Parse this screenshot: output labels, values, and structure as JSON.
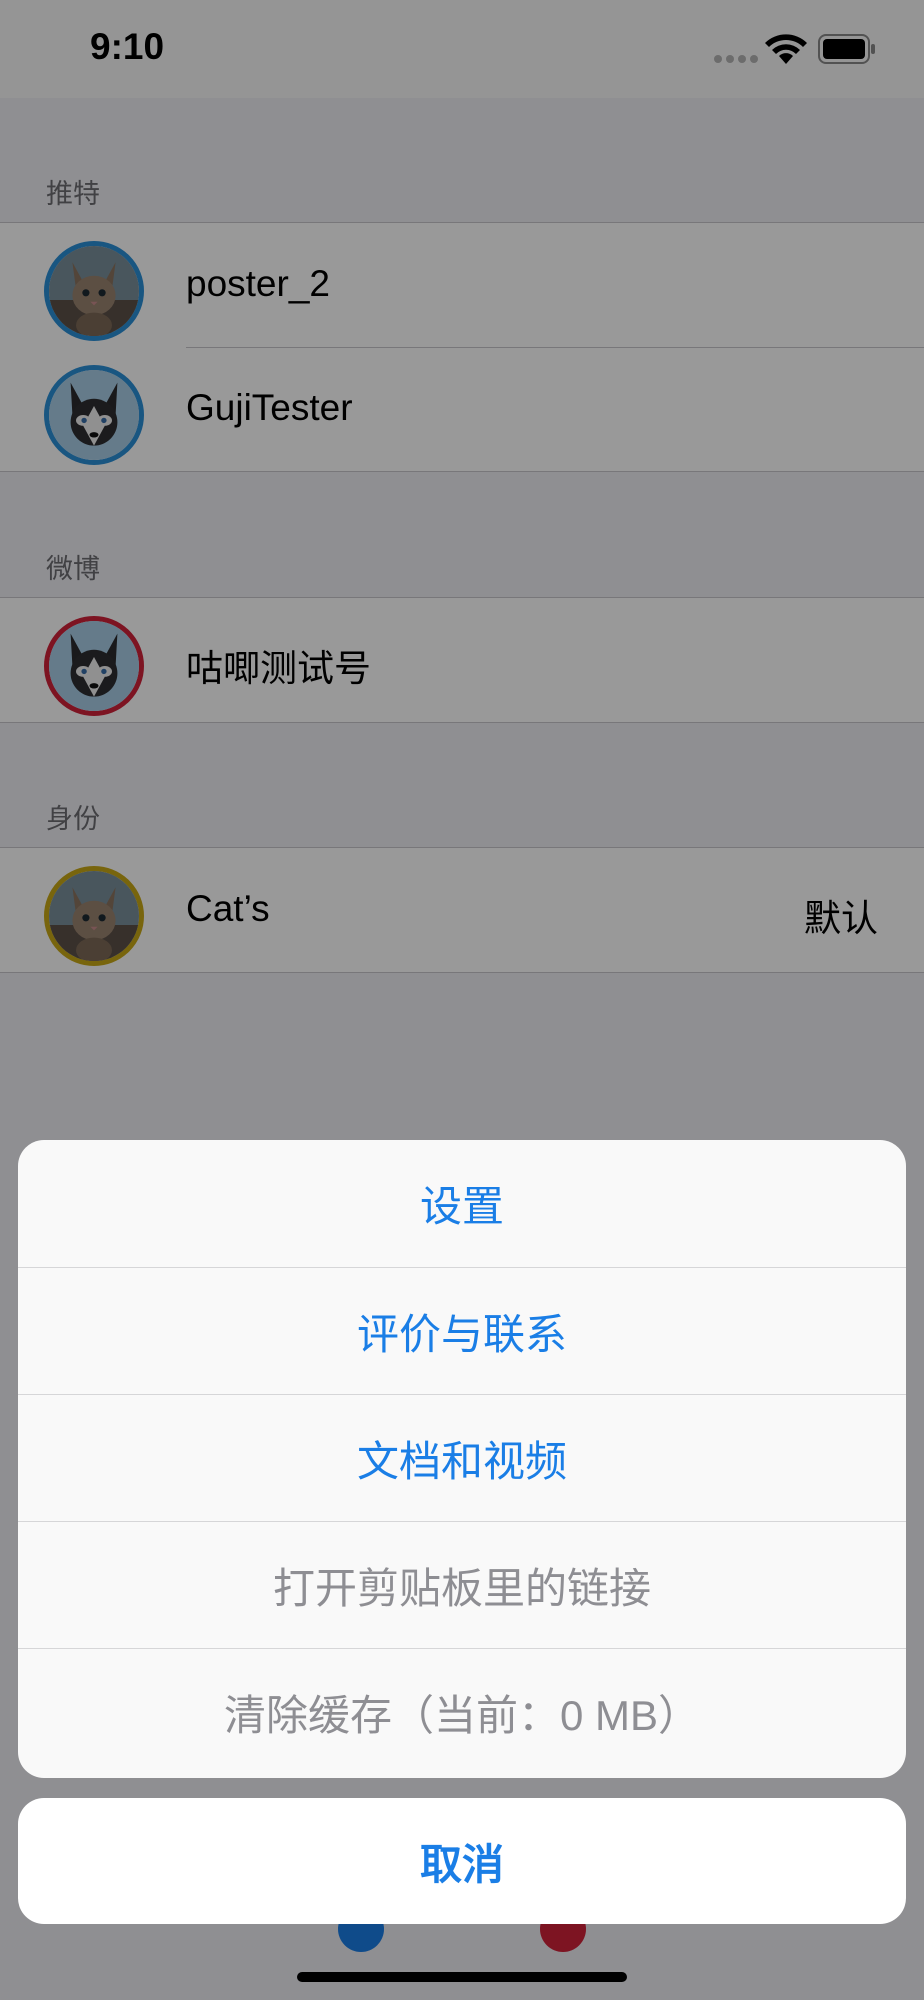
{
  "status_bar": {
    "time": "9:10"
  },
  "sections": [
    {
      "header": "推特",
      "accounts": [
        {
          "name": "poster_2",
          "avatar": "cat-avatar",
          "ring_color": "#2a8fd8"
        },
        {
          "name": "GujiTester",
          "avatar": "husky-avatar",
          "ring_color": "#2a8fd8"
        }
      ]
    },
    {
      "header": "微博",
      "accounts": [
        {
          "name": "咕唧测试号",
          "avatar": "husky-avatar",
          "ring_color": "#d0223a"
        }
      ]
    },
    {
      "header": "身份",
      "accounts": [
        {
          "name": "Cat’s",
          "detail": "默认",
          "avatar": "cat-avatar",
          "ring_color": "#c9a816"
        }
      ]
    }
  ],
  "action_sheet": {
    "items": [
      {
        "label": "设置",
        "enabled": true
      },
      {
        "label": "评价与联系",
        "enabled": true
      },
      {
        "label": "文档和视频",
        "enabled": true
      },
      {
        "label": "打开剪贴板里的链接",
        "enabled": false
      },
      {
        "label": "清除缓存（当前：0 MB）",
        "enabled": false
      }
    ],
    "cancel_label": "取消"
  },
  "colors": {
    "accent": "#1a7ee6",
    "disabled": "#8e8e93",
    "twitter_ring": "#2a8fd8",
    "weibo_ring": "#d0223a",
    "identity_ring": "#c9a816"
  }
}
